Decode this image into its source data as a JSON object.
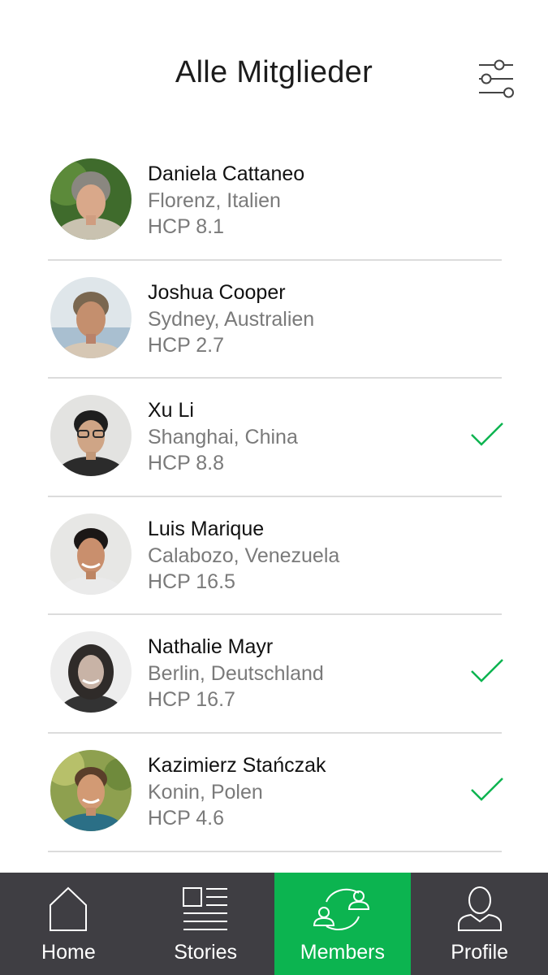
{
  "header": {
    "title": "Alle Mitglieder",
    "filter_icon": "sliders-icon"
  },
  "members": [
    {
      "name": "Daniela Cattaneo",
      "location": "Florenz, Italien",
      "hcp": "HCP 8.1",
      "checked": false
    },
    {
      "name": "Joshua Cooper",
      "location": "Sydney, Australien",
      "hcp": "HCP 2.7",
      "checked": false
    },
    {
      "name": "Xu Li",
      "location": "Shanghai, China",
      "hcp": "HCP 8.8",
      "checked": true
    },
    {
      "name": "Luis Marique",
      "location": "Calabozo, Venezuela",
      "hcp": "HCP 16.5",
      "checked": false
    },
    {
      "name": "Nathalie Mayr",
      "location": "Berlin, Deutschland",
      "hcp": "HCP 16.7",
      "checked": true
    },
    {
      "name": "Kazimierz Stańczak",
      "location": "Konin, Polen",
      "hcp": "HCP 4.6",
      "checked": true
    }
  ],
  "nav": {
    "items": [
      {
        "label": "Home",
        "icon": "home-icon",
        "active": false
      },
      {
        "label": "Stories",
        "icon": "stories-icon",
        "active": false
      },
      {
        "label": "Members",
        "icon": "members-icon",
        "active": true
      },
      {
        "label": "Profile",
        "icon": "profile-icon",
        "active": false
      }
    ]
  },
  "colors": {
    "accent": "#0cb450",
    "nav_bg": "#3f3e43",
    "check": "#0cb450"
  }
}
